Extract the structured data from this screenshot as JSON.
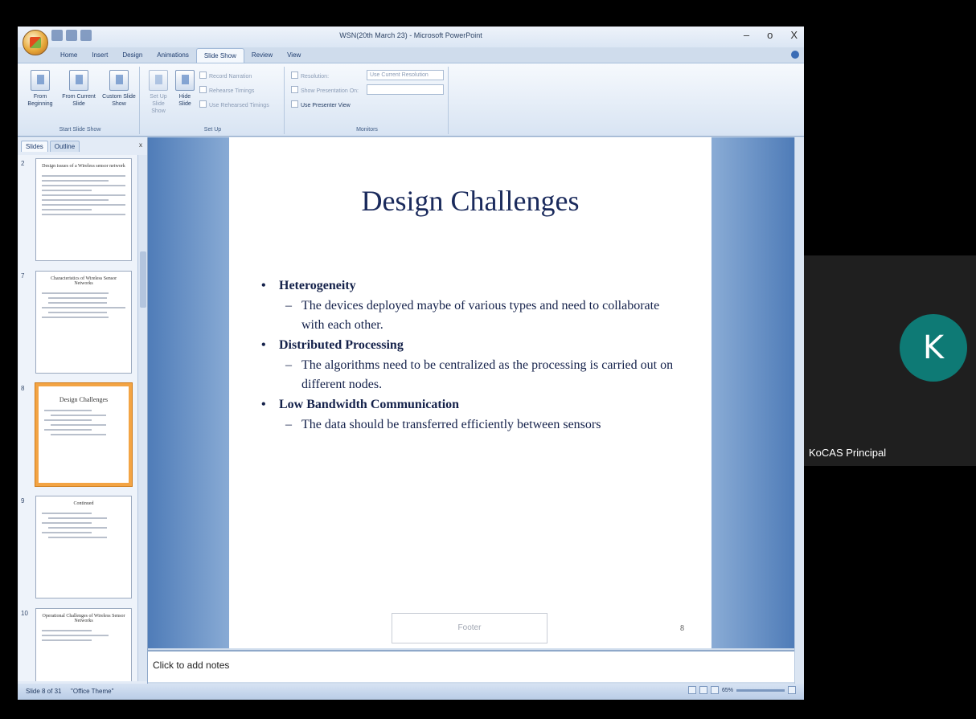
{
  "window": {
    "title": "WSN(20th March 23) - Microsoft PowerPoint",
    "minimize": "–",
    "maximize": "o",
    "close": "X"
  },
  "ribbon": {
    "tabs": [
      "Home",
      "Insert",
      "Design",
      "Animations",
      "Slide Show",
      "Review",
      "View"
    ],
    "active_tab": "Slide Show",
    "start_group": {
      "label": "Start Slide Show",
      "from_beginning": "From Beginning",
      "from_current": "From Current Slide",
      "custom": "Custom Slide Show"
    },
    "setup_group": {
      "label": "Set Up",
      "setup_show": "Set Up Slide Show",
      "hide_slide": "Hide Slide",
      "record_narration": "Record Narration",
      "rehearse_timings": "Rehearse Timings",
      "use_rehearsed": "Use Rehearsed Timings"
    },
    "monitors_group": {
      "label": "Monitors",
      "resolution": "Resolution:",
      "resolution_value": "Use Current Resolution",
      "show_on": "Show Presentation On:",
      "presenter_view": "Use Presenter View"
    }
  },
  "left_pane": {
    "tab_slides": "Slides",
    "tab_outline": "Outline",
    "close": "x",
    "thumbnails": [
      {
        "num": "2",
        "title": "Design issues of a Wireless sensor network"
      },
      {
        "num": "7",
        "title": "Characteristics of Wireless Sensor Networks"
      },
      {
        "num": "8",
        "title": "Design Challenges"
      },
      {
        "num": "9",
        "title": "Continued"
      },
      {
        "num": "10",
        "title": "Operational Challenges of Wireless Sensor Networks"
      }
    ]
  },
  "slide": {
    "title": "Design Challenges",
    "items": [
      {
        "heading": "Heterogeneity",
        "detail": "The devices deployed maybe of various types and need to collaborate with each other."
      },
      {
        "heading": "Distributed Processing",
        "detail": "The algorithms need to be centralized as the processing is carried out on different nodes."
      },
      {
        "heading": "Low Bandwidth Communication",
        "detail": "The data should be transferred efficiently between sensors"
      }
    ],
    "footer": "Footer",
    "page_number": "8"
  },
  "notes": {
    "placeholder": "Click to add notes"
  },
  "status_bar": {
    "slide_info": "Slide 8 of 31",
    "theme": "\"Office Theme\"",
    "zoom": "65%"
  },
  "participant": {
    "initial": "K",
    "name": "KoCAS Principal",
    "avatar_color": "#0e7a75"
  }
}
